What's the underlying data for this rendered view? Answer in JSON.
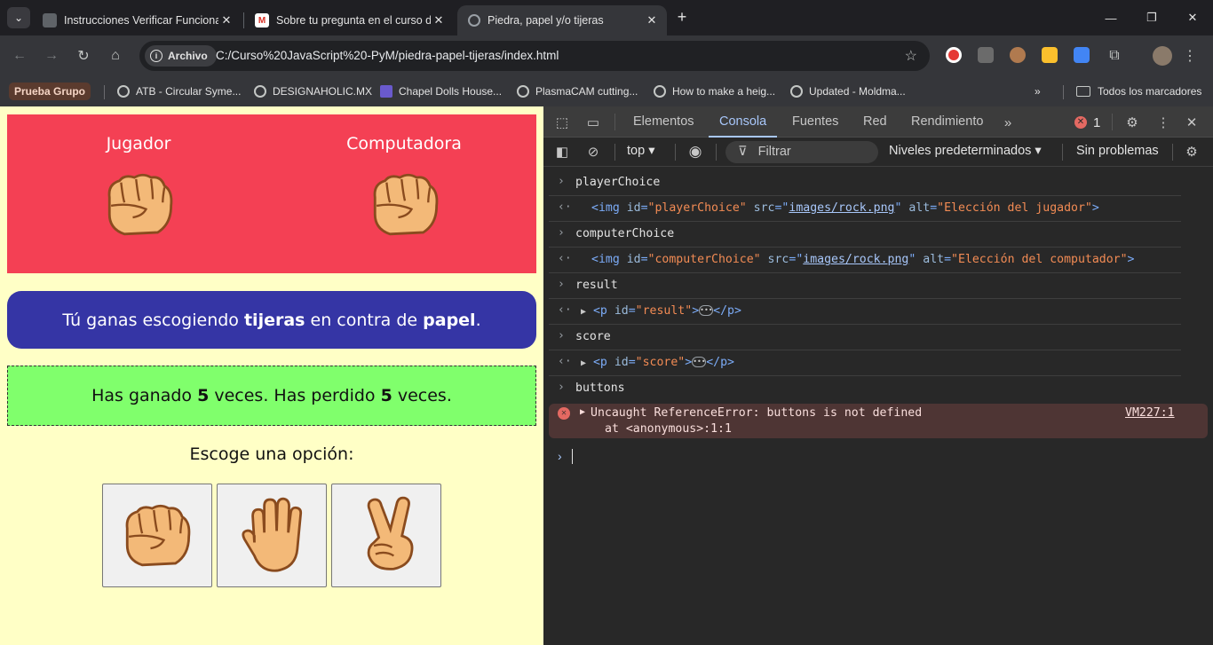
{
  "browser": {
    "tabs": [
      {
        "title": "Instrucciones Verificar Funciona",
        "active": false
      },
      {
        "title": "Sobre tu pregunta en el curso d",
        "active": false
      },
      {
        "title": "Piedra, papel y/o tijeras",
        "active": true
      }
    ],
    "address": {
      "chip": "Archivo",
      "url": "C:/Curso%20JavaScript%20-PyM/piedra-papel-tijeras/index.html"
    },
    "bookmarks": [
      "ATB - Circular Syme...",
      "DESIGNAHOLIC.MX",
      "Chapel Dolls House...",
      "PlasmaCAM cutting...",
      "How to make a heig...",
      "Updated - Moldma..."
    ],
    "bookmark_group": "Prueba Grupo",
    "all_bookmarks": "Todos los marcadores"
  },
  "page": {
    "player_label": "Jugador",
    "computer_label": "Computadora",
    "result": {
      "pre": "Tú ganas escogiendo ",
      "player": "tijeras",
      "mid": " en contra de ",
      "computer": "papel",
      "post": "."
    },
    "score": {
      "pre": "Has ganado ",
      "wins": "5",
      "mid": " veces. Has perdido ",
      "losses": "5",
      "post": " veces."
    },
    "choose": "Escoge una opción:"
  },
  "devtools": {
    "tabs": [
      "Elementos",
      "Consola",
      "Fuentes",
      "Red",
      "Rendimiento"
    ],
    "active_tab": "Consola",
    "error_count": "1",
    "context": "top",
    "filter_placeholder": "Filtrar",
    "levels": "Niveles predeterminados",
    "issues": "Sin problemas",
    "console": {
      "in1": "playerChoice",
      "out1": {
        "tag_open": "<img ",
        "a1": "id",
        "v1": "\"playerChoice\"",
        "a2": "src",
        "v2": "images/rock.png",
        "a3": "alt",
        "v3": "\"Elección del jugador\"",
        "tag_close": ">"
      },
      "in2": "computerChoice",
      "out2": {
        "tag_open": "<img ",
        "a1": "id",
        "v1": "\"computerChoice\"",
        "a2": "src",
        "v2": "images/rock.png",
        "a3": "alt",
        "v3": "\"Elección del computador\"",
        "tag_close": ">"
      },
      "in3": "result",
      "out3": {
        "tag_open": "<p ",
        "a1": "id",
        "v1": "\"result\"",
        "close": "</p>"
      },
      "in4": "score",
      "out4": {
        "tag_open": "<p ",
        "a1": "id",
        "v1": "\"score\"",
        "close": "</p>"
      },
      "in5": "buttons",
      "error": {
        "line1": "Uncaught ReferenceError: buttons is not defined",
        "line2": "at <anonymous>:1:1",
        "source": "VM227:1"
      }
    }
  },
  "colors": {
    "game_bg": "#f44054",
    "result_bg": "#3535a5",
    "score_bg": "#80ff6c",
    "page_bg": "#ffffc6"
  }
}
